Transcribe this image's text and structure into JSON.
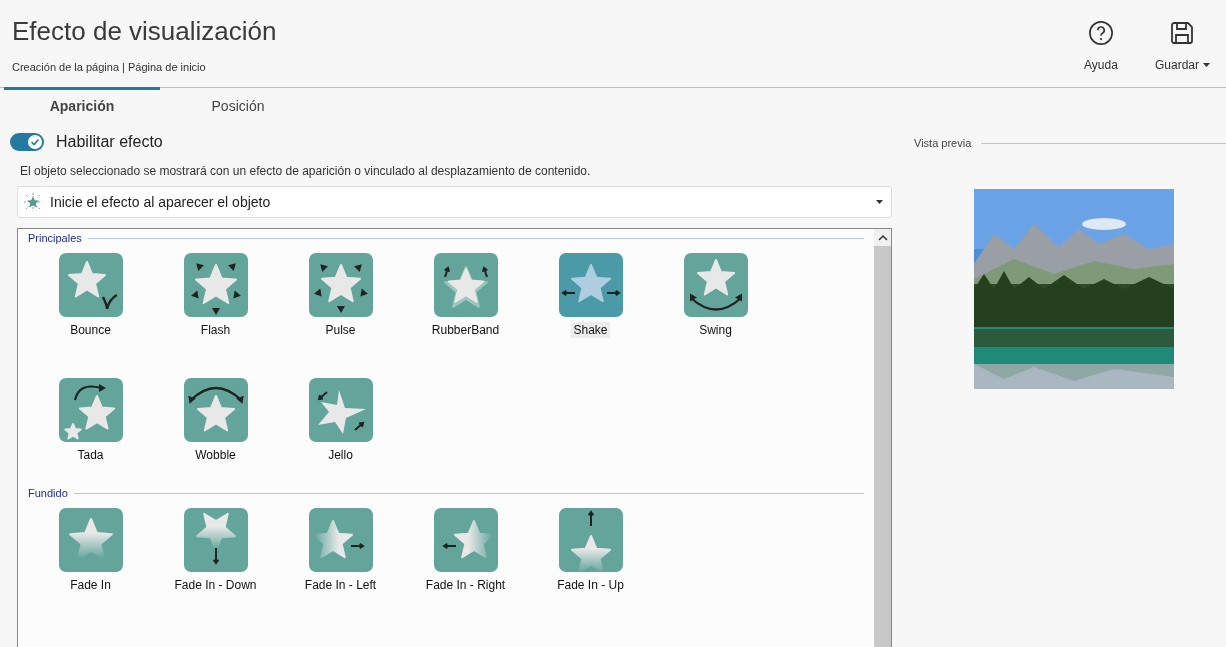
{
  "header": {
    "title": "Efecto de visualización",
    "breadcrumb": "Creación de la página | Página de inicio"
  },
  "toolbar": [
    {
      "label": "Ayuda",
      "kind": "help",
      "dropdown": false
    },
    {
      "label": "Guardar",
      "kind": "save",
      "dropdown": true
    }
  ],
  "tabs": [
    {
      "label": "Aparición",
      "selected": true
    },
    {
      "label": "Posición",
      "selected": false
    }
  ],
  "enable_toggle": {
    "label": "Habilitar efecto",
    "on": true
  },
  "description": "El objeto seleccionado se mostrará con un efecto de aparición o vinculado al desplazamiento de contenido.",
  "trigger_select": {
    "value": "Inicie el efecto al aparecer el objeto"
  },
  "groups": [
    {
      "title": "Principales",
      "effects": [
        {
          "label": "Bounce",
          "kind": "bounce",
          "selected": false
        },
        {
          "label": "Flash",
          "kind": "flash",
          "selected": false
        },
        {
          "label": "Pulse",
          "kind": "pulse",
          "selected": false
        },
        {
          "label": "RubberBand",
          "kind": "rubberband",
          "selected": false
        },
        {
          "label": "Shake",
          "kind": "shake",
          "selected": true
        },
        {
          "label": "Swing",
          "kind": "swing",
          "selected": false
        },
        {
          "label": "Tada",
          "kind": "tada",
          "selected": false
        },
        {
          "label": "Wobble",
          "kind": "wobble",
          "selected": false
        },
        {
          "label": "Jello",
          "kind": "jello",
          "selected": false
        }
      ]
    },
    {
      "title": "Fundido",
      "effects": [
        {
          "label": "Fade In",
          "kind": "fade",
          "selected": false
        },
        {
          "label": "Fade In - Down",
          "kind": "fade-down",
          "selected": false
        },
        {
          "label": "Fade In - Left",
          "kind": "fade-left",
          "selected": false
        },
        {
          "label": "Fade In - Right",
          "kind": "fade-right",
          "selected": false
        },
        {
          "label": "Fade In - Up",
          "kind": "fade-up",
          "selected": false
        }
      ]
    }
  ],
  "preview": {
    "label": "Vista previa"
  }
}
